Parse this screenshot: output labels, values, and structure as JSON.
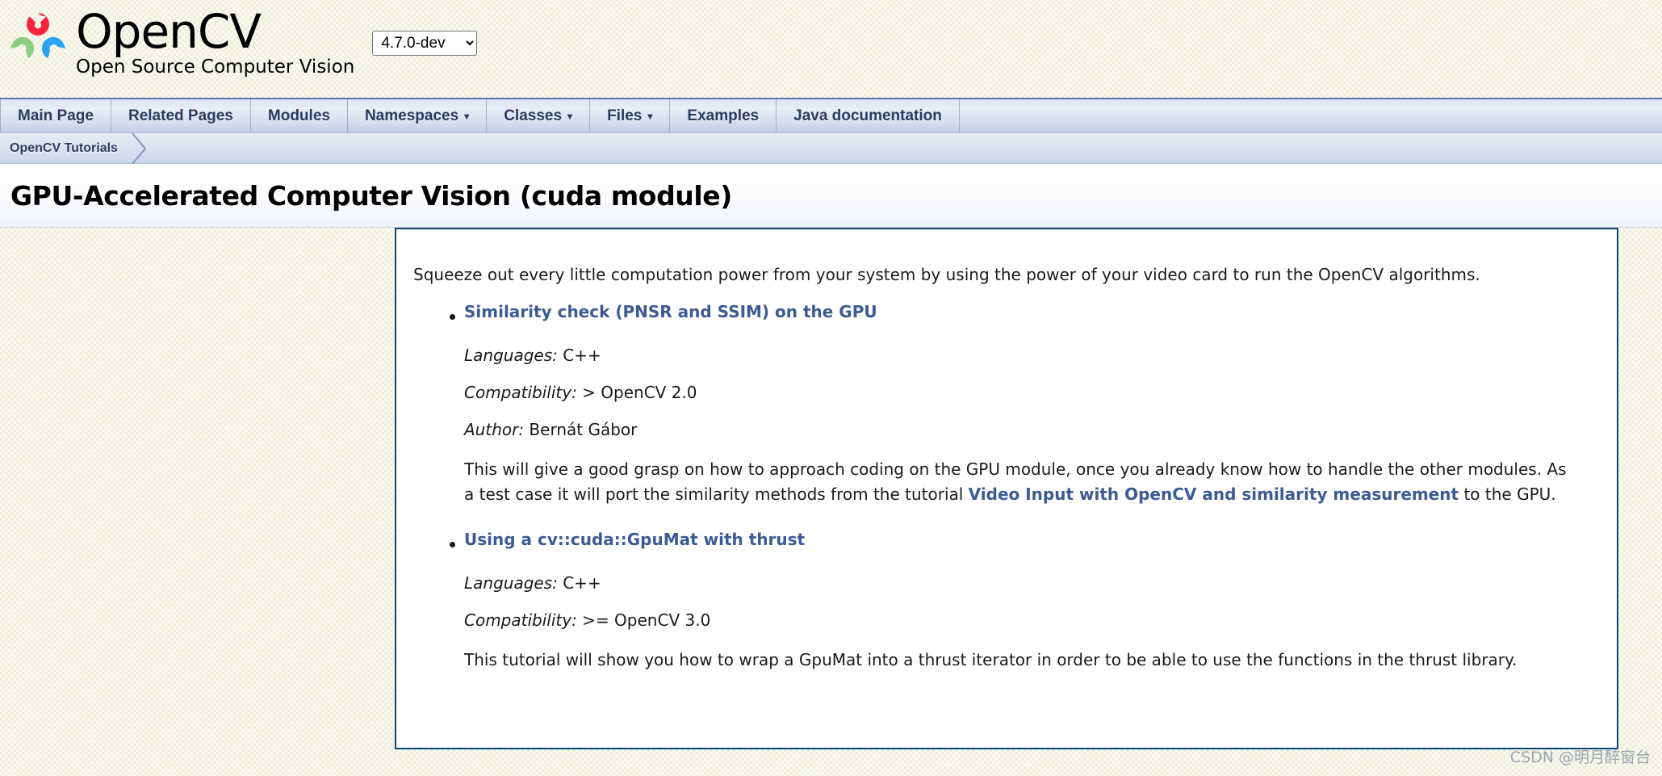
{
  "header": {
    "logo_icon": "opencv-logo-icon",
    "brand_title": "OpenCV",
    "brand_subtitle": "Open Source Computer Vision",
    "version_selected": "4.7.0-dev",
    "version_options": [
      "4.7.0-dev"
    ]
  },
  "nav": {
    "items": [
      {
        "label": "Main Page",
        "has_caret": false,
        "name": "nav-main-page"
      },
      {
        "label": "Related Pages",
        "has_caret": false,
        "name": "nav-related-pages"
      },
      {
        "label": "Modules",
        "has_caret": false,
        "name": "nav-modules"
      },
      {
        "label": "Namespaces",
        "has_caret": true,
        "name": "nav-namespaces"
      },
      {
        "label": "Classes",
        "has_caret": true,
        "name": "nav-classes"
      },
      {
        "label": "Files",
        "has_caret": true,
        "name": "nav-files"
      },
      {
        "label": "Examples",
        "has_caret": false,
        "name": "nav-examples"
      },
      {
        "label": "Java documentation",
        "has_caret": false,
        "name": "nav-java-documentation"
      }
    ],
    "caret_glyph": "▾"
  },
  "breadcrumb": {
    "items": [
      {
        "label": "OpenCV Tutorials",
        "name": "breadcrumb-opencv-tutorials"
      }
    ]
  },
  "page": {
    "title": "GPU-Accelerated Computer Vision (cuda module)"
  },
  "content": {
    "intro": "Squeeze out every little computation power from your system by using the power of your video card to run the OpenCV algorithms.",
    "tutorials": [
      {
        "link_title": "Similarity check (PNSR and SSIM) on the GPU",
        "languages_key": "Languages:",
        "languages_value": "C++",
        "compatibility_key": "Compatibility:",
        "compatibility_value": "> OpenCV 2.0",
        "author_key": "Author:",
        "author_value": "Bernát Gábor",
        "description_before": "This will give a good grasp on how to approach coding on the GPU module, once you already know how to handle the other modules. As a test case it will port the similarity methods from the tutorial ",
        "description_link": "Video Input with OpenCV and similarity measurement",
        "description_after": " to the GPU."
      },
      {
        "link_title": "Using a cv::cuda::GpuMat with thrust",
        "languages_key": "Languages:",
        "languages_value": "C++",
        "compatibility_key": "Compatibility:",
        "compatibility_value": ">= OpenCV 3.0",
        "description_before": "This tutorial will show you how to wrap a GpuMat into a thrust iterator in order to be able to use the functions in the thrust library.",
        "description_link": "",
        "description_after": ""
      }
    ]
  },
  "watermark": {
    "text": "CSDN @明月醉窗台"
  },
  "colors": {
    "link": "#3c5a94",
    "nav_text": "#283a5d",
    "panel_border": "#0d4471",
    "page_bg": "#fcfcf5",
    "logo_red": "#f8253d",
    "logo_green": "#8ace7e",
    "logo_blue": "#2aa3f0"
  }
}
